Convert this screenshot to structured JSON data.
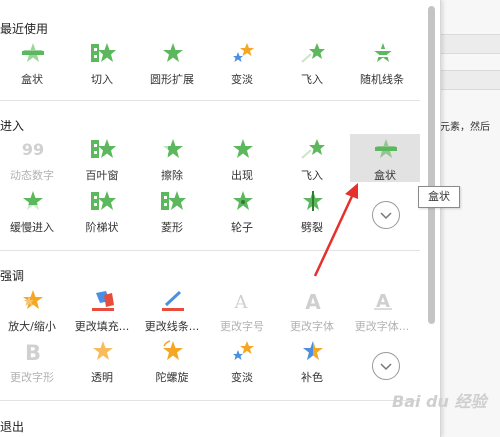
{
  "background_text": "个元素，然后",
  "sections": {
    "recent": "最近使用",
    "enter": "进入",
    "emphasis": "强调",
    "exit": "退出"
  },
  "recent": [
    "盒状",
    "切入",
    "圆形扩展",
    "变淡",
    "飞入",
    "随机线条"
  ],
  "enter_row1": [
    "动态数字",
    "百叶窗",
    "擦除",
    "出现",
    "飞入",
    "盒状"
  ],
  "enter_row2": [
    "缓慢进入",
    "阶梯状",
    "菱形",
    "轮子",
    "劈裂"
  ],
  "emphasis_row1": [
    "放大/缩小",
    "更改填充...",
    "更改线条...",
    "更改字号",
    "更改字体",
    "更改字体..."
  ],
  "emphasis_row2": [
    "更改字形",
    "透明",
    "陀螺旋",
    "变淡",
    "补色"
  ],
  "tooltip": "盒状",
  "icon_glyphs": {
    "font_a": "A",
    "font_b": "B"
  },
  "watermark": "Bai du 经验",
  "colors": {
    "green_star": "#5cb85c",
    "orange_star": "#f5a623",
    "arrow": "#e5302c"
  }
}
